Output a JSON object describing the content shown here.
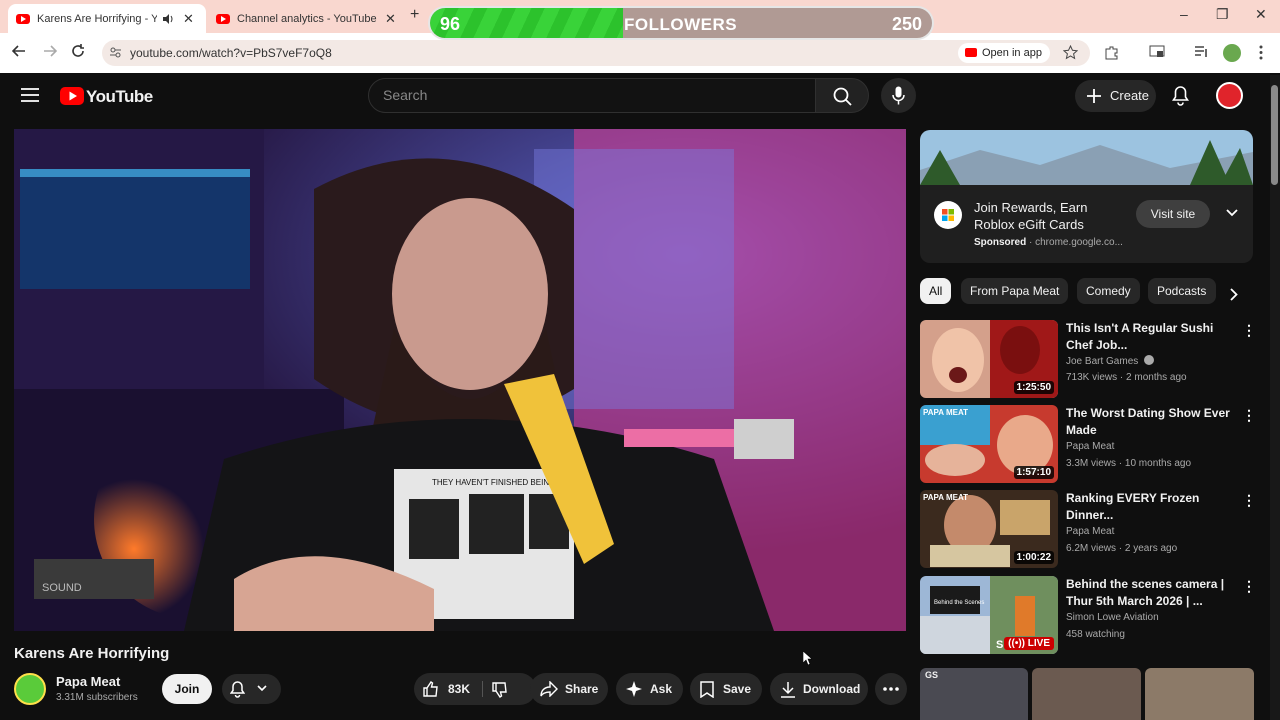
{
  "browser": {
    "tabs": [
      {
        "title": "Karens Are Horrifying - YouTube",
        "close": "✕"
      },
      {
        "title": "Channel analytics - YouTube Studio",
        "close": "✕"
      }
    ],
    "new_tab": "+",
    "window_controls": [
      "–",
      "❐",
      "✕"
    ],
    "url": "youtube.com/watch?v=PbS7veF7oQ8",
    "open_in_app": "Open in app"
  },
  "followers_bar": {
    "current": "96",
    "label": "FOLLOWERS",
    "goal": "250",
    "progress": 0.384
  },
  "youtube": {
    "logo_text": "YouTube",
    "search_placeholder": "Search",
    "create_label": "Create"
  },
  "video": {
    "title": "Karens Are Horrifying",
    "channel": "Papa Meat",
    "subscribers": "3.31M subscribers",
    "join_label": "Join",
    "likes": "83K",
    "share_label": "Share",
    "ask_label": "Ask",
    "save_label": "Save",
    "download_label": "Download"
  },
  "ad": {
    "title": "Join Rewards, Earn Roblox eGift Cards",
    "sponsored": "Sponsored",
    "domain": "chrome.google.co...",
    "visit_label": "Visit site"
  },
  "chips": [
    "All",
    "From Papa Meat",
    "Comedy",
    "Podcasts"
  ],
  "recommendations": [
    {
      "title": "This Isn't A Regular Sushi Chef Job...",
      "channel": "Joe Bart Games",
      "meta": "713K views · 2 months ago",
      "duration": "1:25:50"
    },
    {
      "title": "The Worst Dating Show Ever Made",
      "channel": "Papa Meat",
      "meta": "3.3M views · 10 months ago",
      "duration": "1:57:10"
    },
    {
      "title": "Ranking EVERY Frozen Dinner...",
      "channel": "Papa Meat",
      "meta": "6.2M views · 2 years ago",
      "duration": "1:00:22"
    },
    {
      "title": "Behind the scenes camera | Thur 5th March  2026 | ...",
      "channel": "Simon Lowe Aviation",
      "meta": "458 watching",
      "duration": "LIVE"
    }
  ],
  "thumb_overlays": {
    "papa_meat_logo": "PAPA MEAT",
    "behind_scenes_sign": "Behind the Scenes",
    "gs_badge": "GS",
    "right_edge_badge": "S",
    "shirt_text": "THEY HAVEN'T FINISHED BEING ALIVE",
    "box_text": "SOUND"
  }
}
